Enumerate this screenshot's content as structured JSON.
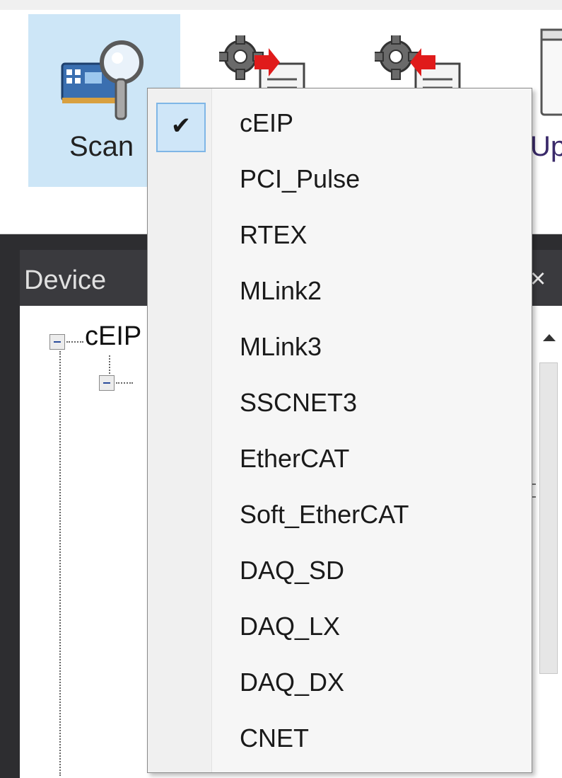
{
  "toolbar": {
    "scan_label": "Scan",
    "up_label": "Up"
  },
  "panel": {
    "title": "Device",
    "close_glyph": "×",
    "tree": {
      "root_label": "cEIP",
      "child_label": ""
    }
  },
  "menu": {
    "checked_glyph": "✔",
    "items": [
      {
        "label": "cEIP",
        "checked": true
      },
      {
        "label": "PCI_Pulse",
        "checked": false
      },
      {
        "label": "RTEX",
        "checked": false
      },
      {
        "label": "MLink2",
        "checked": false
      },
      {
        "label": "MLink3",
        "checked": false
      },
      {
        "label": "SSCNET3",
        "checked": false
      },
      {
        "label": "EtherCAT",
        "checked": false
      },
      {
        "label": "Soft_EtherCAT",
        "checked": false
      },
      {
        "label": "DAQ_SD",
        "checked": false
      },
      {
        "label": "DAQ_LX",
        "checked": false
      },
      {
        "label": "DAQ_DX",
        "checked": false
      },
      {
        "label": "CNET",
        "checked": false
      }
    ]
  },
  "colors": {
    "scan_highlight": "#cde6f7",
    "check_highlight": "#cfe6f8",
    "panel_dark": "#2d2d30"
  },
  "icons": {
    "scan": "scan-magnifier-icon",
    "config_export": "gear-document-export-icon",
    "config_import": "gear-document-import-icon",
    "update": "update-window-icon"
  }
}
